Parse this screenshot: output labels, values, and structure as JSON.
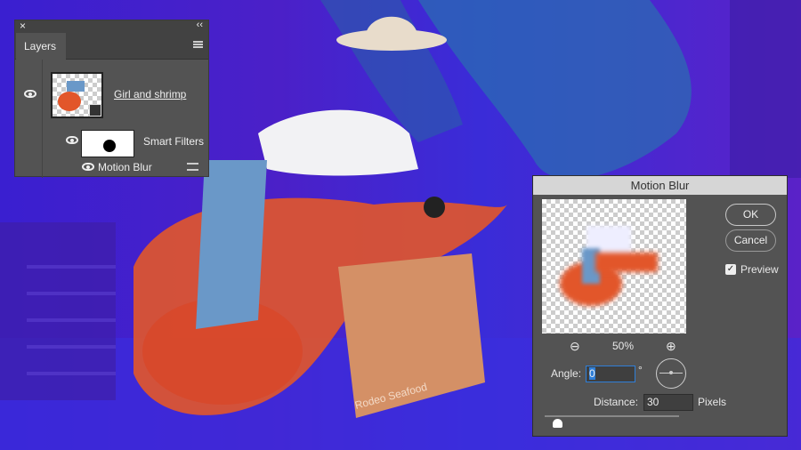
{
  "layers_panel": {
    "close": "×",
    "collapse": "‹‹",
    "tab": "Layers",
    "layer_name": "Girl and shrimp",
    "smart_filters": "Smart Filters",
    "filter_name": "Motion Blur"
  },
  "dialog": {
    "title": "Motion Blur",
    "ok": "OK",
    "cancel": "Cancel",
    "preview_label": "Preview",
    "preview_checked": true,
    "zoom": "50%",
    "angle_label": "Angle:",
    "angle_value": "0",
    "degree": "°",
    "distance_label": "Distance:",
    "distance_value": "30",
    "distance_unit": "Pixels",
    "slider_fraction": 0.1
  },
  "artwork": {
    "bag_text": "Rodeo Seafood"
  },
  "colors": {
    "background": "#3a1fd0",
    "shrimp": "#e2562a",
    "panel": "#535353"
  }
}
